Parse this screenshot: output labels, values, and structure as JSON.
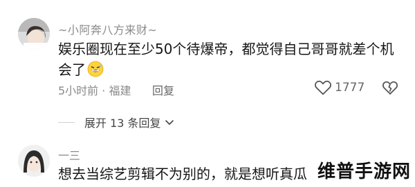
{
  "comment1": {
    "username": "~小阿奔八方来财~",
    "content": "娱乐圈现在至少50个待爆帝，都觉得自己哥哥就差个机会了",
    "emoji_icon": "grinning-sweat-emoji-icon",
    "time_location": "5小时前 · 福建",
    "reply_label": "回复",
    "like_count": "1777",
    "like_icon": "heart-icon",
    "dislike_icon": "broken-heart-icon"
  },
  "replies": {
    "expand_label": "展开 13 条回复",
    "chevron_icon": "chevron-down-icon"
  },
  "comment2": {
    "username": "一三",
    "content": "想去当综艺剪辑不为别的，就是想听真瓜"
  },
  "watermark": {
    "text": "维普手游网"
  },
  "colors": {
    "text_primary": "#161616",
    "text_secondary": "#8a8a8a",
    "action": "#666666",
    "background": "#ffffff"
  }
}
